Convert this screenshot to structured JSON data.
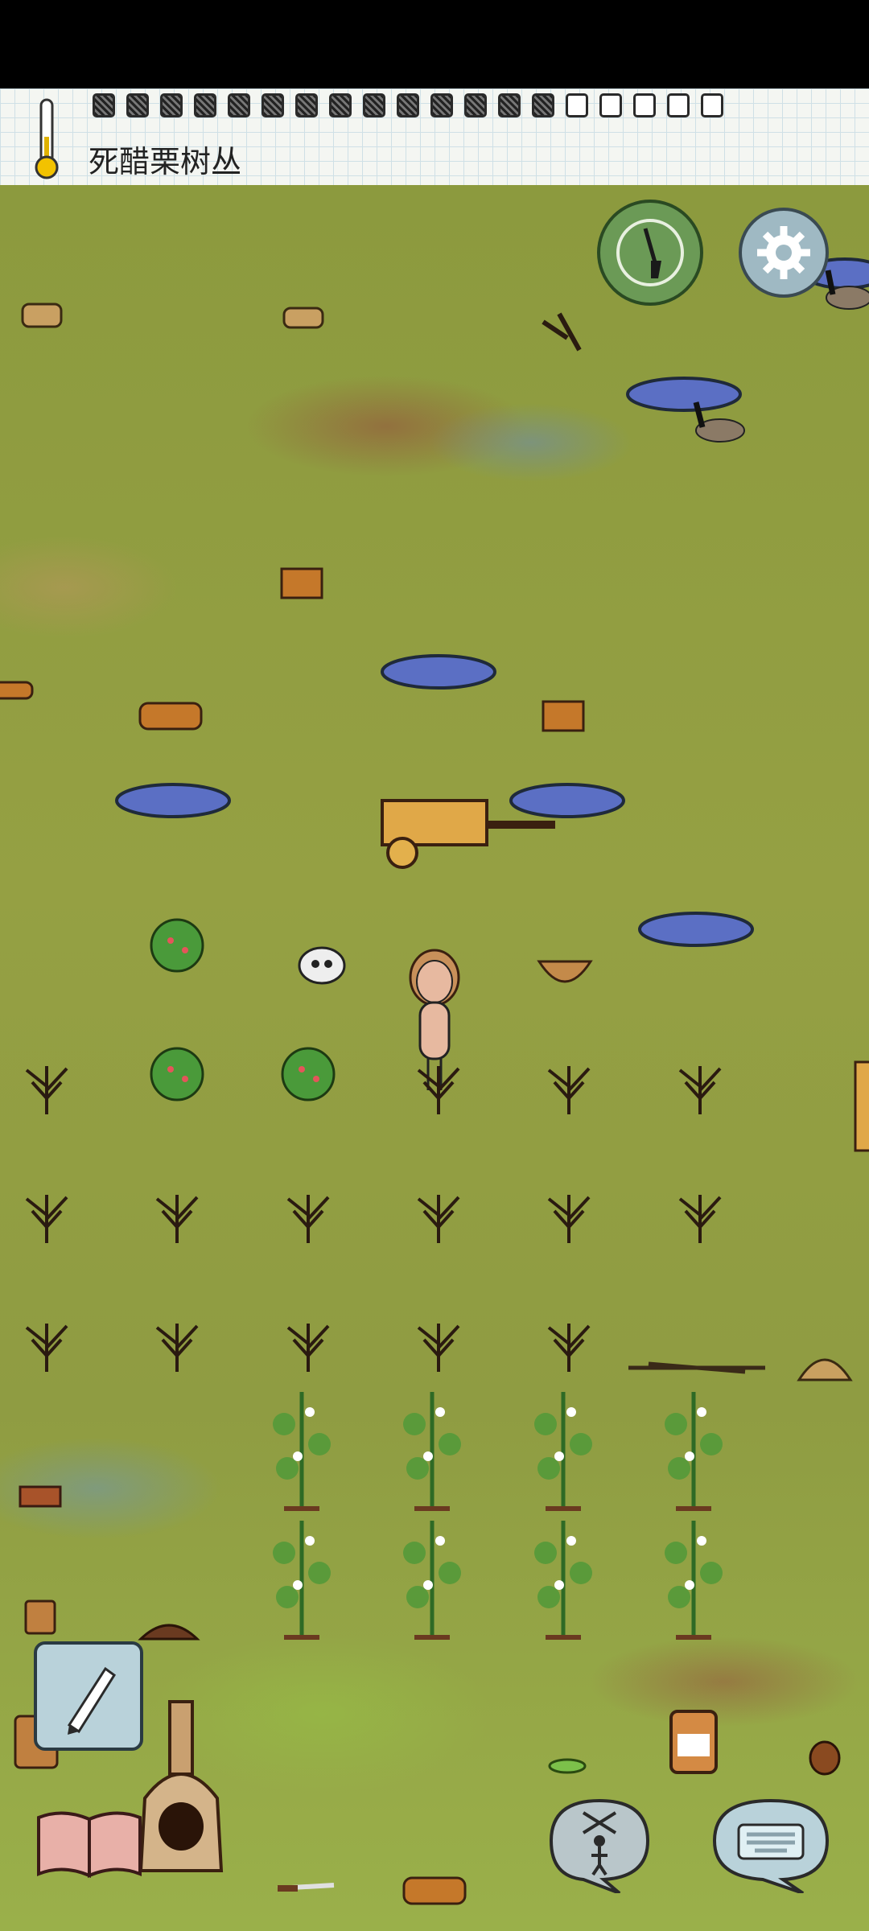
{
  "hud": {
    "hover_label": "死醋栗树丛",
    "thermometer_icon": "thermometer-icon",
    "temperature_scale": {
      "filled_pips": 14,
      "total_pips": 19
    }
  },
  "buttons": {
    "compass_icon": "compass-shovel-icon",
    "settings_icon": "gear-icon",
    "note_icon": "pencil-icon",
    "recipe_book_icon": "open-book-icon",
    "emote_icon": "puppet-icon",
    "chat_icon": "keyboard-icon"
  },
  "colors": {
    "grass": "#8f9c42",
    "water": "#5b6fc4",
    "button_blue": "#b9d2da",
    "compass_green": "#6b9a56"
  }
}
